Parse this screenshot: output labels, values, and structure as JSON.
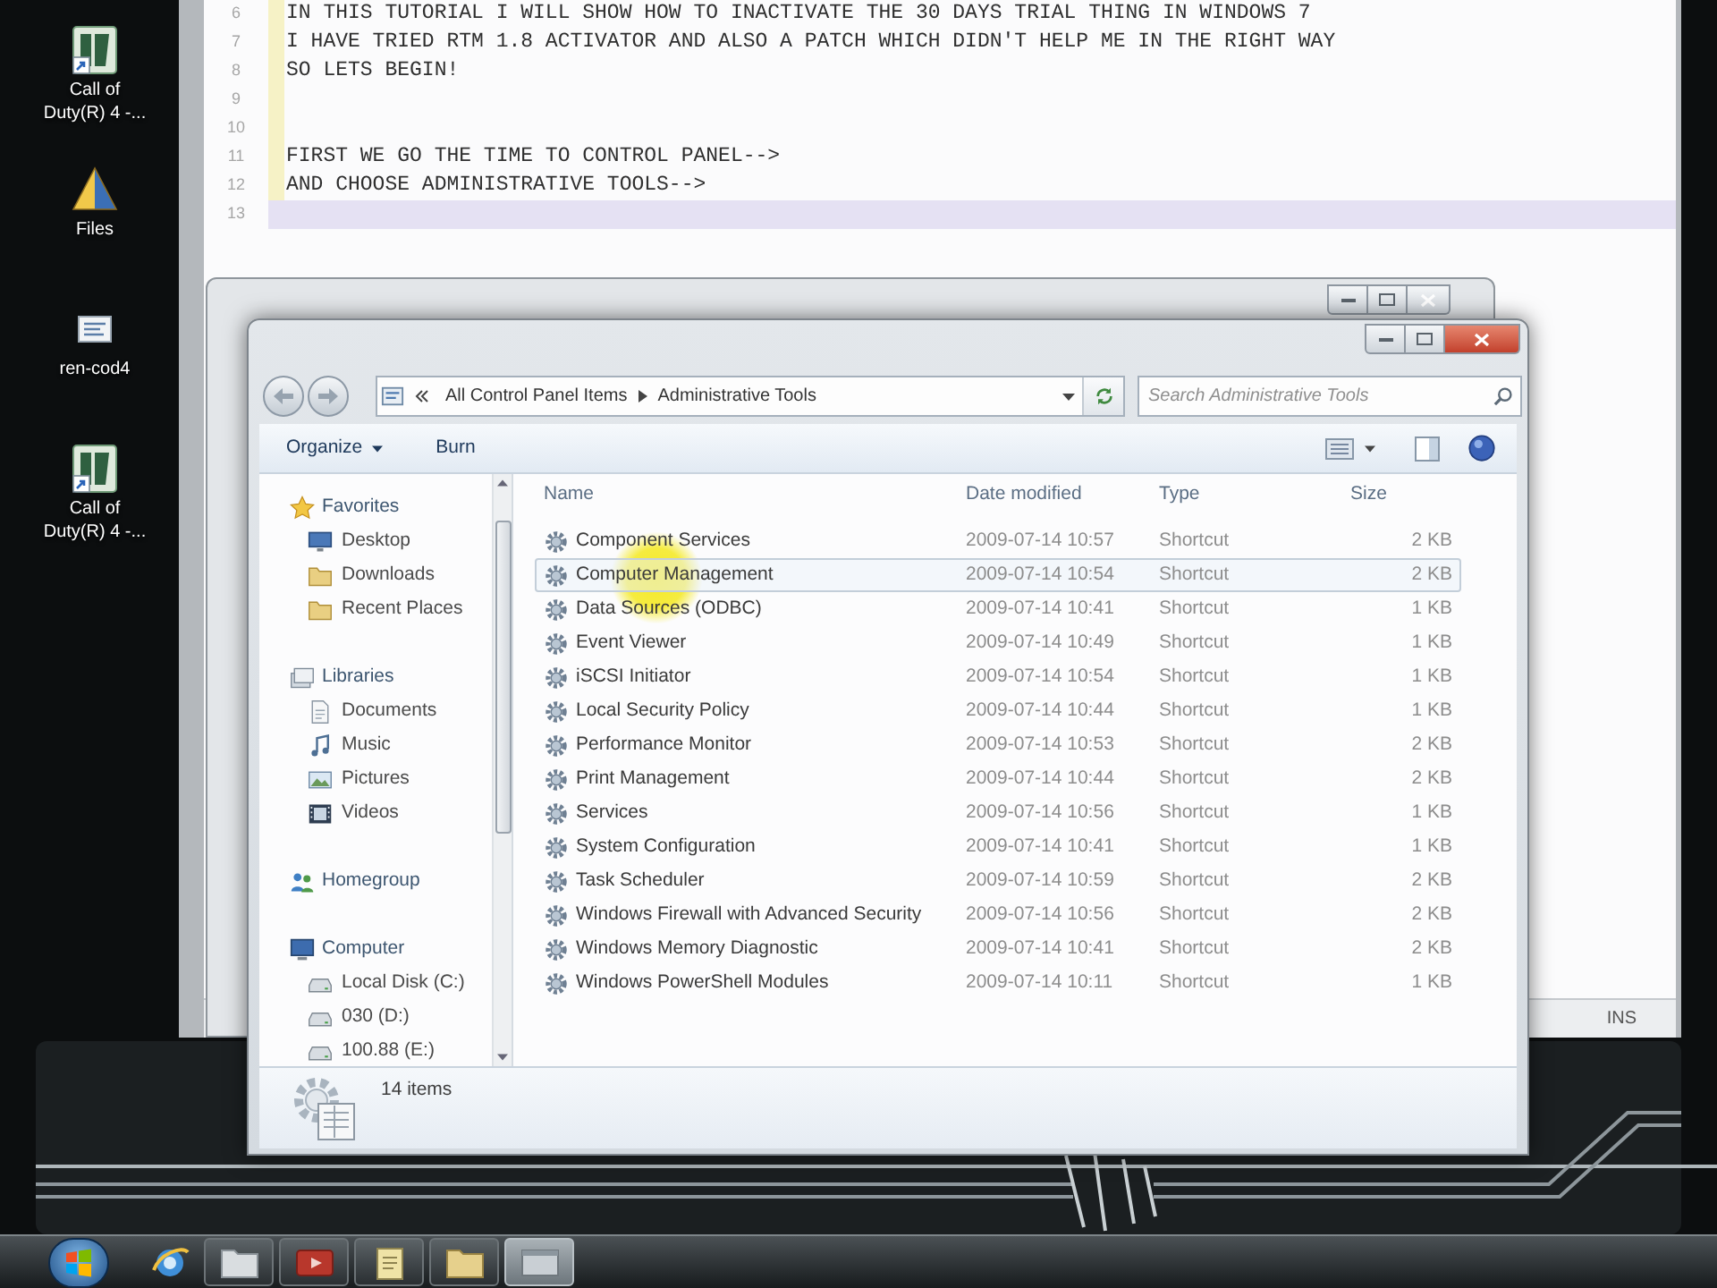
{
  "desktop_icons": [
    {
      "label": "Call of Duty(R) 4 -..."
    },
    {
      "label": "Files"
    },
    {
      "label": "ren-cod4"
    },
    {
      "label": "Call of Duty(R) 4 -..."
    }
  ],
  "editor": {
    "lines": [
      {
        "number": "6",
        "text": "IN THIS TUTORIAL I WILL SHOW HOW TO INACTIVATE THE 30 DAYS TRIAL THING IN WINDOWS 7",
        "current": false
      },
      {
        "number": "7",
        "text": "I HAVE TRIED RTM 1.8 ACTIVATOR AND ALSO A PATCH WHICH DIDN'T HELP ME IN THE RIGHT WAY",
        "current": false
      },
      {
        "number": "8",
        "text": "SO LETS BEGIN!",
        "current": false
      },
      {
        "number": "9",
        "current": false
      },
      {
        "number": "10",
        "current": false
      },
      {
        "number": "11",
        "text": "FIRST WE GO THE TIME TO CONTROL PANEL-->",
        "current": false
      },
      {
        "number": "12",
        "text": "AND CHOOSE ADMINISTRATIVE TOOLS-->",
        "current": false
      },
      {
        "number": "13",
        "current": true
      }
    ],
    "status": "INS"
  },
  "explorer": {
    "address": {
      "path": [
        "All Control Panel Items",
        "Administrative Tools"
      ]
    },
    "search": {
      "placeholder": "Search Administrative Tools"
    },
    "toolbar": [
      {
        "label": "Organize",
        "menu": true
      },
      {
        "label": "Burn",
        "menu": false
      }
    ],
    "navigation": [
      {
        "label": "Favorites",
        "children": [
          {
            "label": "Desktop"
          },
          {
            "label": "Downloads"
          },
          {
            "label": "Recent Places"
          }
        ]
      },
      {
        "label": "Libraries",
        "children": [
          {
            "label": "Documents"
          },
          {
            "label": "Music"
          },
          {
            "label": "Pictures"
          },
          {
            "label": "Videos"
          }
        ]
      },
      {
        "label": "Homegroup"
      },
      {
        "label": "Computer",
        "children": [
          {
            "label": "Local Disk (C:)"
          },
          {
            "label": "030 (D:)"
          },
          {
            "label": "100.88 (E:)"
          }
        ]
      }
    ],
    "columns": [
      "Name",
      "Date modified",
      "Type",
      "Size"
    ],
    "rows": [
      {
        "name": "Component Services",
        "date_modified": "2009-07-14 10:57",
        "type": "Shortcut",
        "size": "2 KB",
        "highlighted": false
      },
      {
        "name": "Computer Management",
        "date_modified": "2009-07-14 10:54",
        "type": "Shortcut",
        "size": "2 KB",
        "highlighted": true
      },
      {
        "name": "Data Sources (ODBC)",
        "date_modified": "2009-07-14 10:41",
        "type": "Shortcut",
        "size": "1 KB",
        "highlighted": false
      },
      {
        "name": "Event Viewer",
        "date_modified": "2009-07-14 10:49",
        "type": "Shortcut",
        "size": "1 KB",
        "highlighted": false
      },
      {
        "name": "iSCSI Initiator",
        "date_modified": "2009-07-14 10:54",
        "type": "Shortcut",
        "size": "1 KB",
        "highlighted": false
      },
      {
        "name": "Local Security Policy",
        "date_modified": "2009-07-14 10:44",
        "type": "Shortcut",
        "size": "1 KB",
        "highlighted": false
      },
      {
        "name": "Performance Monitor",
        "date_modified": "2009-07-14 10:53",
        "type": "Shortcut",
        "size": "2 KB",
        "highlighted": false
      },
      {
        "name": "Print Management",
        "date_modified": "2009-07-14 10:44",
        "type": "Shortcut",
        "size": "2 KB",
        "highlighted": false
      },
      {
        "name": "Services",
        "date_modified": "2009-07-14 10:56",
        "type": "Shortcut",
        "size": "1 KB",
        "highlighted": false
      },
      {
        "name": "System Configuration",
        "date_modified": "2009-07-14 10:41",
        "type": "Shortcut",
        "size": "1 KB",
        "highlighted": false
      },
      {
        "name": "Task Scheduler",
        "date_modified": "2009-07-14 10:59",
        "type": "Shortcut",
        "size": "2 KB",
        "highlighted": false
      },
      {
        "name": "Windows Firewall with Advanced Security",
        "date_modified": "2009-07-14 10:56",
        "type": "Shortcut",
        "size": "2 KB",
        "highlighted": false
      },
      {
        "name": "Windows Memory Diagnostic",
        "date_modified": "2009-07-14 10:41",
        "type": "Shortcut",
        "size": "2 KB",
        "highlighted": false
      },
      {
        "name": "Windows PowerShell Modules",
        "date_modified": "2009-07-14 10:11",
        "type": "Shortcut",
        "size": "1 KB",
        "highlighted": false
      }
    ],
    "status_bar": "14 items"
  }
}
